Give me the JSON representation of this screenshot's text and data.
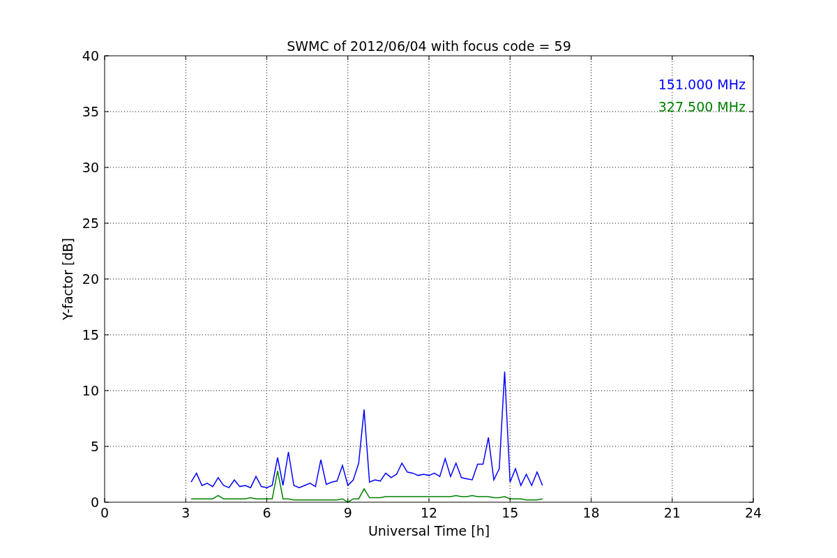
{
  "figure": {
    "chart_data": {
      "type": "line",
      "title": "SWMC of 2012/06/04 with focus code = 59",
      "xlabel": "Universal Time [h]",
      "ylabel": "Y-factor [dB]",
      "xlim": [
        0,
        24
      ],
      "ylim": [
        0,
        40
      ],
      "xticks": [
        0,
        3,
        6,
        9,
        12,
        15,
        18,
        21,
        24
      ],
      "yticks": [
        0,
        5,
        10,
        15,
        20,
        25,
        30,
        35,
        40
      ],
      "grid": true,
      "x": [
        3.2,
        3.4,
        3.6,
        3.8,
        4.0,
        4.2,
        4.4,
        4.6,
        4.8,
        5.0,
        5.2,
        5.4,
        5.6,
        5.8,
        6.0,
        6.2,
        6.4,
        6.6,
        6.8,
        7.0,
        7.2,
        7.4,
        7.6,
        7.8,
        8.0,
        8.2,
        8.4,
        8.6,
        8.8,
        9.0,
        9.2,
        9.4,
        9.6,
        9.8,
        10.0,
        10.2,
        10.4,
        10.6,
        10.8,
        11.0,
        11.2,
        11.4,
        11.6,
        11.8,
        12.0,
        12.2,
        12.4,
        12.6,
        12.8,
        13.0,
        13.2,
        13.4,
        13.6,
        13.8,
        14.0,
        14.2,
        14.4,
        14.6,
        14.8,
        15.0,
        15.2,
        15.4,
        15.6,
        15.8,
        16.0,
        16.2
      ],
      "series": [
        {
          "name": "151.000 MHz",
          "color": "#0000ff",
          "values": [
            1.8,
            2.6,
            1.5,
            1.7,
            1.4,
            2.2,
            1.5,
            1.3,
            2.0,
            1.4,
            1.5,
            1.3,
            2.3,
            1.4,
            1.3,
            1.5,
            4.0,
            1.5,
            4.5,
            1.5,
            1.3,
            1.5,
            1.7,
            1.4,
            3.8,
            1.6,
            1.8,
            1.9,
            3.3,
            1.5,
            2.0,
            3.5,
            8.3,
            1.8,
            2.0,
            1.9,
            2.6,
            2.2,
            2.5,
            3.5,
            2.7,
            2.6,
            2.4,
            2.5,
            2.4,
            2.6,
            2.3,
            3.9,
            2.3,
            3.5,
            2.2,
            2.1,
            2.0,
            3.4,
            3.4,
            5.8,
            2.0,
            3.0,
            11.7,
            1.8,
            3.0,
            1.5,
            2.5,
            1.5,
            2.7,
            1.5
          ]
        },
        {
          "name": "327.500 MHz",
          "color": "#008000",
          "values": [
            0.3,
            0.3,
            0.3,
            0.3,
            0.3,
            0.6,
            0.3,
            0.3,
            0.3,
            0.3,
            0.3,
            0.4,
            0.3,
            0.3,
            0.3,
            0.3,
            2.8,
            0.3,
            0.3,
            0.2,
            0.2,
            0.2,
            0.2,
            0.2,
            0.2,
            0.2,
            0.2,
            0.2,
            0.3,
            0.0,
            0.3,
            0.3,
            1.2,
            0.4,
            0.4,
            0.4,
            0.5,
            0.5,
            0.5,
            0.5,
            0.5,
            0.5,
            0.5,
            0.5,
            0.5,
            0.5,
            0.5,
            0.5,
            0.5,
            0.6,
            0.5,
            0.5,
            0.6,
            0.5,
            0.5,
            0.5,
            0.4,
            0.4,
            0.5,
            0.3,
            0.3,
            0.3,
            0.2,
            0.2,
            0.2,
            0.3
          ]
        }
      ]
    }
  }
}
